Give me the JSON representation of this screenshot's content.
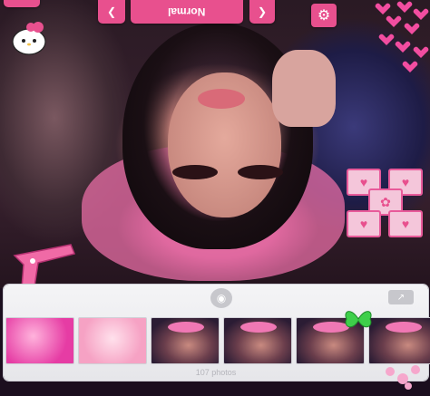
{
  "toolbar": {
    "mode_label": "Normal",
    "prev_icon": "chevron-left-icon",
    "next_icon": "chevron-right-icon",
    "settings_icon": "gear-icon"
  },
  "photo_tray": {
    "camera_icon": "camera-icon",
    "share_icon": "share-icon",
    "photo_count": "107 photos",
    "thumbnails": [
      "thumb-1",
      "thumb-2",
      "thumb-3",
      "thumb-4",
      "thumb-5",
      "thumb-6"
    ]
  },
  "colors": {
    "accent": "#e8508e",
    "tray": "#efeff2"
  }
}
